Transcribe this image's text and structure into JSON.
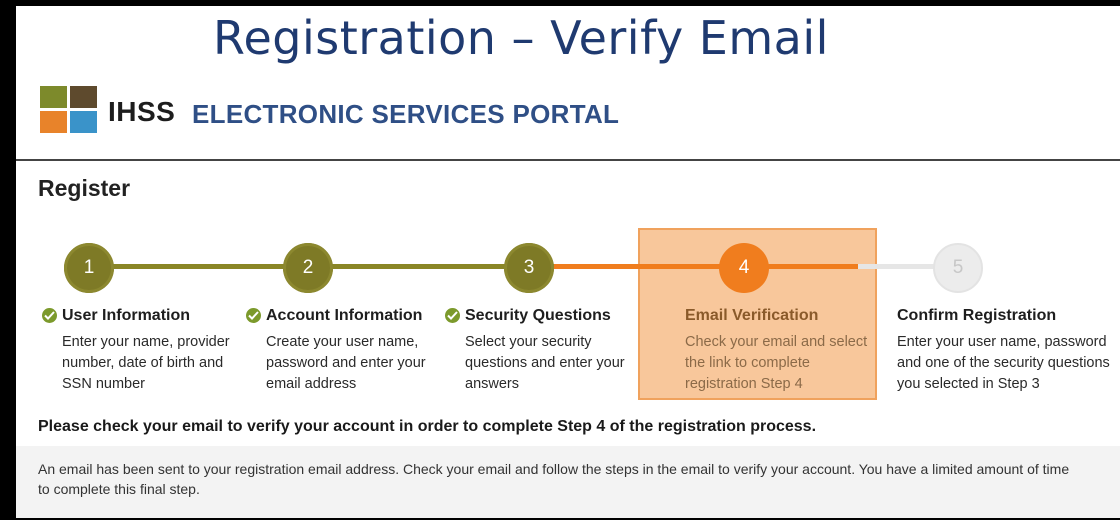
{
  "slide": {
    "title": "Registration – Verify Email"
  },
  "portal": {
    "logo_text": "IHSS",
    "name": "ELECTRONIC SERVICES PORTAL",
    "logo_colors": [
      "#7d8a2b",
      "#5e4a2d",
      "#e8832a",
      "#3a93c9"
    ]
  },
  "register": {
    "heading": "Register"
  },
  "colors": {
    "completed": "#7e7a26",
    "active": "#f07d1e",
    "pending": "#ececec",
    "highlight": "#f8c79b",
    "title": "#1f3a70",
    "portal_name": "#2f4f86"
  },
  "steps": [
    {
      "number": "1",
      "title": "User Information",
      "description": "Enter your name, provider number, date of birth and SSN number",
      "status": "completed"
    },
    {
      "number": "2",
      "title": "Account Information",
      "description": "Create your user name, password and enter your email address",
      "status": "completed"
    },
    {
      "number": "3",
      "title": "Security Questions",
      "description": "Select your security questions and enter your answers",
      "status": "completed"
    },
    {
      "number": "4",
      "title": "Email Verification",
      "description": "Check your email and select the link to complete registration Step 4",
      "status": "active"
    },
    {
      "number": "5",
      "title": "Confirm Registration",
      "description": "Enter your user name, password and one of the security questions you selected in Step 3",
      "status": "pending"
    }
  ],
  "notice": "Please check your email to verify your account in order to complete Step 4 of the registration process.",
  "info": "An email has been sent to your registration email address. Check your email and follow the steps in the email to verify your account. You have a limited amount of time to complete this final step."
}
